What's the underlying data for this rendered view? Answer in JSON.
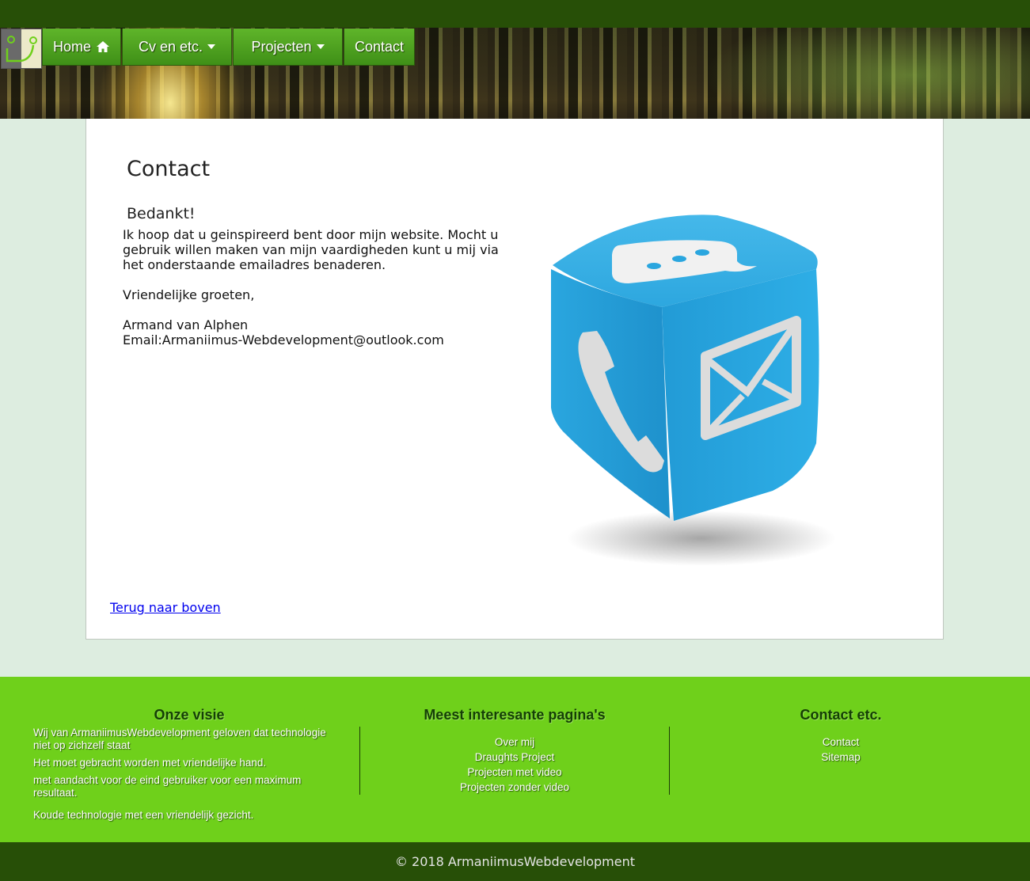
{
  "nav": {
    "items": [
      {
        "label": "Home",
        "icon": "home-icon"
      },
      {
        "label": "Cv en etc.",
        "icon": "caret-down-icon"
      },
      {
        "label": "Projecten",
        "icon": "caret-down-icon"
      },
      {
        "label": "Contact"
      }
    ]
  },
  "main": {
    "title": "Contact",
    "subtitle": "Bedankt!",
    "paragraph": "Ik hoop dat u geinspireerd bent door mijn website. Mocht u gebruik willen maken van mijn vaardigheden kunt u mij via het onderstaande emailadres benaderen.",
    "greeting": "Vriendelijke groeten,",
    "name": "Armand van Alphen",
    "email": "Email:Armaniimus-Webdevelopment@outlook.com",
    "back_to_top": "Terug naar boven"
  },
  "footer": {
    "vision": {
      "title": "Onze visie",
      "lines": [
        "Wij van ArmaniimusWebdevelopment geloven dat technologie niet op zichzelf staat",
        "Het moet gebracht worden met vriendelijke hand.",
        "met aandacht voor de eind gebruiker voor een maximum resultaat.",
        "Koude technologie met een vriendelijk gezicht."
      ]
    },
    "pages": {
      "title": "Meest interesante pagina's",
      "links": [
        "Over mij",
        "Draughts Project",
        "Projecten met video",
        "Projecten zonder video"
      ]
    },
    "contact": {
      "title": "Contact etc.",
      "links": [
        "Contact",
        "Sitemap"
      ]
    }
  },
  "copyright": "© 2018 ArmaniimusWebdevelopment",
  "colors": {
    "top_bar": "#274f07",
    "nav_green": "#4fa21f",
    "footer_green": "#6fd01b",
    "page_bg": "#ddede0",
    "cube_blue": "#2aa6df"
  }
}
